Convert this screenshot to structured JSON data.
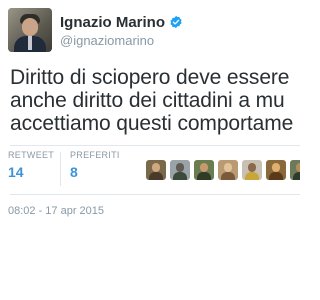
{
  "tweet": {
    "author": {
      "name": "Ignazio Marino",
      "handle": "@ignaziomarino",
      "verified": true
    },
    "text_lines": [
      "Diritto di sciopero deve essere",
      "anche diritto dei cittadini a mu",
      "accettiamo questi comportame"
    ],
    "stats": {
      "retweet_label": "RETWEET",
      "retweet_count": "14",
      "favorites_label": "PREFERITI",
      "favorites_count": "8"
    },
    "favoriters": [
      {
        "icon": "user-avatar-icon",
        "bg": "#7a6a4a",
        "head": "#d1a981",
        "body": "#4a3a2a"
      },
      {
        "icon": "user-avatar-icon",
        "bg": "#9aa3a8",
        "head": "#5f5a52",
        "body": "#3c4a3a"
      },
      {
        "icon": "user-avatar-icon",
        "bg": "#6a7d4e",
        "head": "#c69a6e",
        "body": "#2f3b26"
      },
      {
        "icon": "user-avatar-icon",
        "bg": "#b99a72",
        "head": "#e2c29a",
        "body": "#7a5a3a"
      },
      {
        "icon": "user-avatar-icon",
        "bg": "#c8c0b2",
        "head": "#8a6a4a",
        "body": "#c9a63a"
      },
      {
        "icon": "user-avatar-icon",
        "bg": "#8a6a3a",
        "head": "#e0b070",
        "body": "#5a3a1a"
      },
      {
        "icon": "user-avatar-icon",
        "bg": "#6b7b5a",
        "head": "#b68a5e",
        "body": "#2e3a2a"
      }
    ],
    "timestamp": "08:02 - 17 apr 2015"
  },
  "colors": {
    "link_blue": "#3b94d9",
    "muted_gray": "#8899a6",
    "text_dark": "#292f33",
    "verified_blue": "#1da1f2"
  }
}
